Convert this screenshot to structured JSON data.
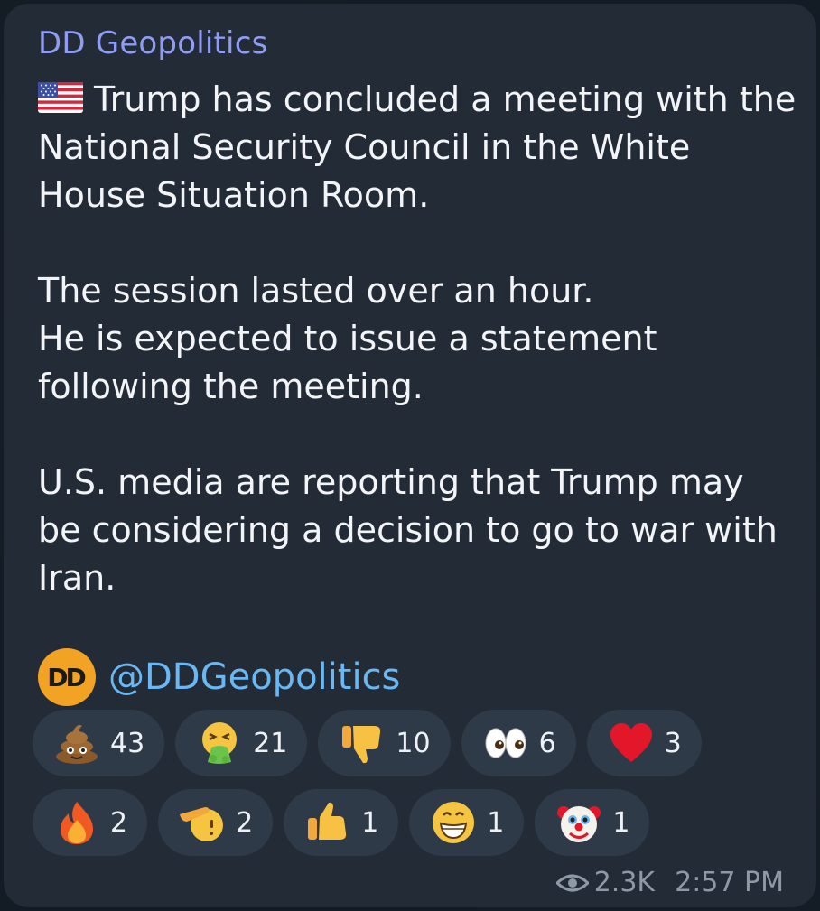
{
  "message": {
    "channel_name": "DD Geopolitics",
    "flag_icon": "us-flag-icon",
    "paragraphs": [
      "Trump has concluded a meeting with the National Security Council in the White House Situation Room.",
      "The session lasted over an hour.\nHe is expected to issue a statement following the meeting.",
      "U.S. media are reporting that Trump may be considering a decision to go to war with Iran."
    ],
    "signature_logo_text": "DD",
    "signature_handle": "@DDGeopolitics",
    "views": "2.3K",
    "time": "2:57 PM"
  },
  "reactions": [
    {
      "emoji": "poop-icon",
      "count": "43"
    },
    {
      "emoji": "vomiting-face-icon",
      "count": "21"
    },
    {
      "emoji": "thumbs-down-icon",
      "count": "10"
    },
    {
      "emoji": "eyes-icon",
      "count": "6"
    },
    {
      "emoji": "heart-icon",
      "count": "3"
    },
    {
      "emoji": "fire-icon",
      "count": "2"
    },
    {
      "emoji": "saluting-face-icon",
      "count": "2"
    },
    {
      "emoji": "thumbs-up-icon",
      "count": "1"
    },
    {
      "emoji": "grinning-face-icon",
      "count": "1"
    },
    {
      "emoji": "clown-face-icon",
      "count": "1"
    }
  ],
  "colors": {
    "bubble": "#222b36",
    "channel_name": "#8f9cf2",
    "link": "#69b7f3",
    "reaction_pill": "#2f3a48",
    "meta_text": "#8e99a6"
  }
}
